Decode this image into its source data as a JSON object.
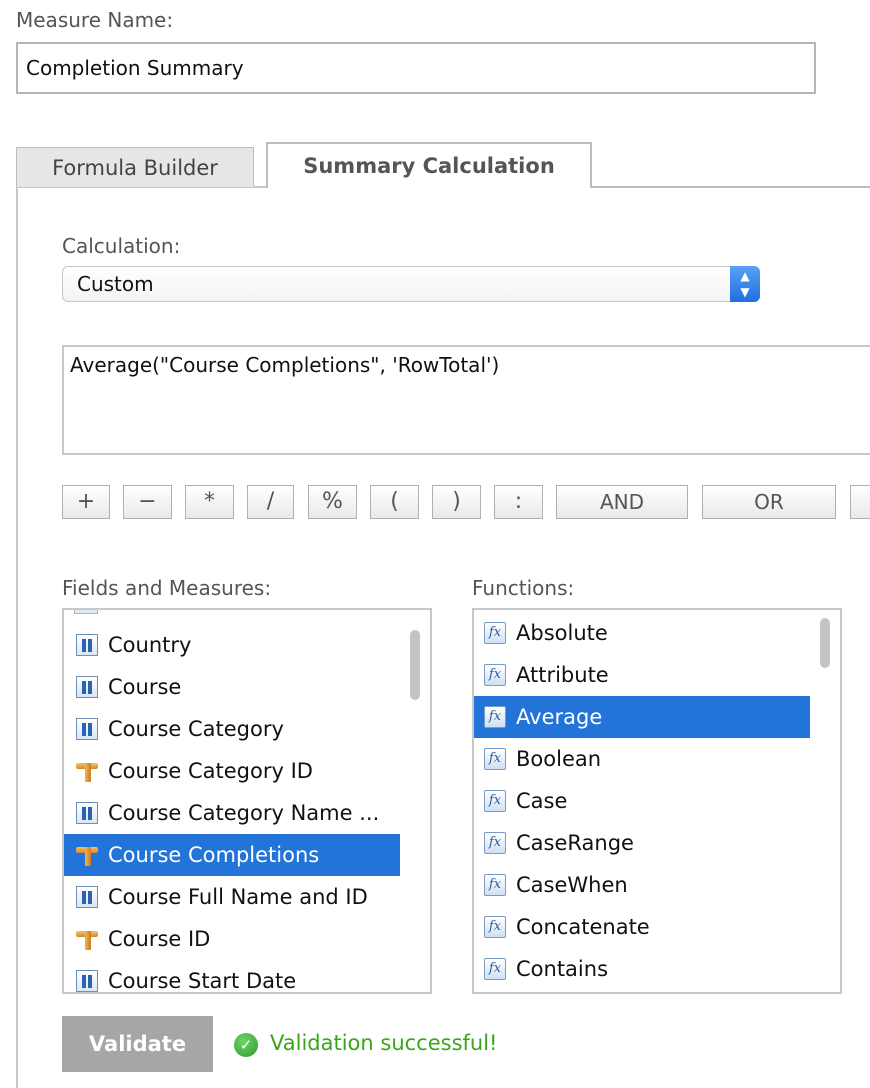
{
  "measure": {
    "label": "Measure Name:",
    "value": "Completion Summary"
  },
  "tabs": [
    {
      "label": "Formula Builder",
      "active": false
    },
    {
      "label": "Summary Calculation",
      "active": true
    }
  ],
  "calculation": {
    "label": "Calculation:",
    "selected": "Custom"
  },
  "formula": {
    "text": "Average(\"Course Completions\", 'RowTotal')"
  },
  "operators": [
    "+",
    "−",
    "*",
    "/",
    "%",
    "(",
    ")",
    ":",
    "AND",
    "OR"
  ],
  "fields": {
    "label": "Fields and Measures:",
    "items": [
      {
        "text": "Country",
        "icon": "field-icon",
        "selected": false
      },
      {
        "text": "Course",
        "icon": "field-icon",
        "selected": false
      },
      {
        "text": "Course Category",
        "icon": "field-icon",
        "selected": false
      },
      {
        "text": "Course Category ID",
        "icon": "measure-icon",
        "selected": false
      },
      {
        "text": "Course Category Name ...",
        "icon": "field-icon",
        "selected": false
      },
      {
        "text": "Course Completions",
        "icon": "measure-icon",
        "selected": true
      },
      {
        "text": "Course Full Name and ID",
        "icon": "field-icon",
        "selected": false
      },
      {
        "text": "Course ID",
        "icon": "measure-icon",
        "selected": false
      },
      {
        "text": "Course Start Date",
        "icon": "field-icon",
        "selected": false
      }
    ]
  },
  "functions": {
    "label": "Functions:",
    "items": [
      {
        "text": "Absolute",
        "selected": false
      },
      {
        "text": "Attribute",
        "selected": false
      },
      {
        "text": "Average",
        "selected": true
      },
      {
        "text": "Boolean",
        "selected": false
      },
      {
        "text": "Case",
        "selected": false
      },
      {
        "text": "CaseRange",
        "selected": false
      },
      {
        "text": "CaseWhen",
        "selected": false
      },
      {
        "text": "Concatenate",
        "selected": false
      },
      {
        "text": "Contains",
        "selected": false
      }
    ]
  },
  "validate": {
    "label": "Validate",
    "status": "Validation successful!"
  },
  "colors": {
    "selection": "#2374d9",
    "success": "#3aa51b",
    "button_disabled": "#a6a6a6"
  }
}
